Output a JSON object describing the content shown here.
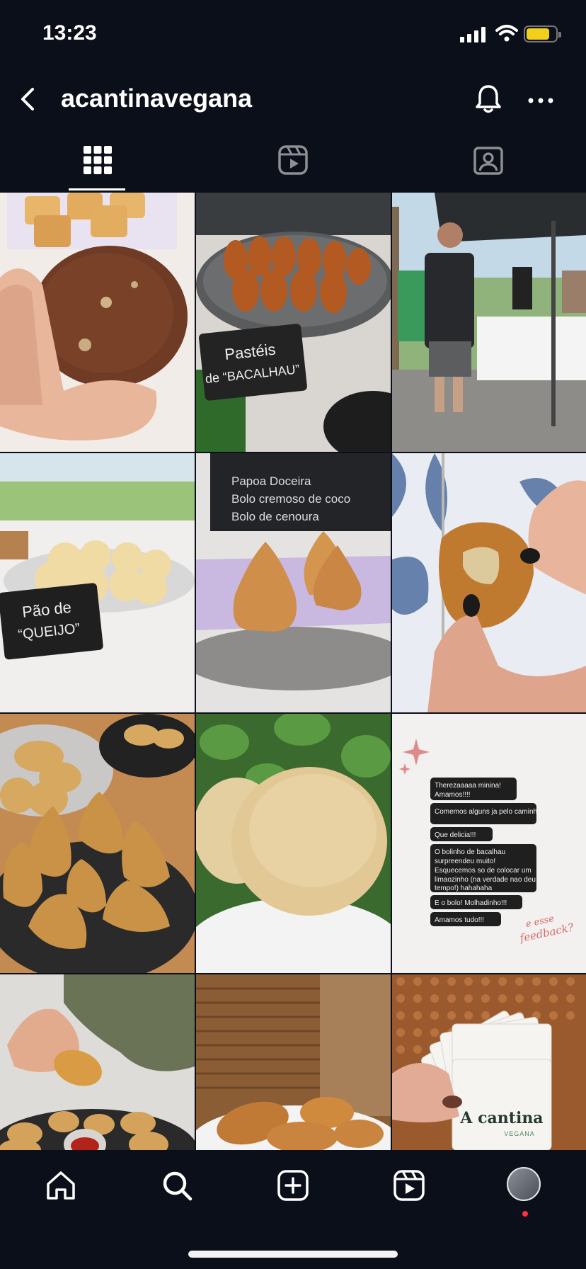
{
  "status_bar": {
    "time": "13:23"
  },
  "header": {
    "username": "acantinavegana"
  },
  "tabs": [
    {
      "icon": "grid-icon"
    },
    {
      "icon": "reels-icon"
    },
    {
      "icon": "tagged-icon"
    }
  ],
  "posts": [
    {
      "labels": []
    },
    {
      "labels": [
        "Pastéis",
        "de “BACALHAU”"
      ]
    },
    {
      "labels": []
    },
    {
      "labels": [
        "Pão de",
        "“QUEIJO”"
      ]
    },
    {
      "labels": [
        "Papoa Doceira",
        "Bolo cremoso de coco",
        "Bolo de cenoura"
      ]
    },
    {
      "labels": []
    },
    {
      "labels": []
    },
    {
      "labels": []
    },
    {
      "labels": [
        "Therezaaaaa minina!",
        "Amamos!!!!",
        "Comemos alguns ja pelo caminho",
        "Que delicia!!!",
        "O bolinho de bacalhau",
        "surpreendeu muito!",
        "Esquecemos so de colocar um",
        "limaozinho (na verdade nao deu",
        "tempo!) hahahaha",
        "E o bolo! Molhadinho!!!",
        "Amamos tudo!!!",
        "e esse",
        "feedback?"
      ]
    },
    {
      "labels": []
    },
    {
      "labels": []
    },
    {
      "labels": [
        "A cantina",
        "VEGANA"
      ]
    }
  ],
  "bottom_nav": [
    "home-icon",
    "search-icon",
    "create-icon",
    "reels-icon",
    "profile-avatar"
  ],
  "colors": {
    "background": "#0b0f19",
    "notification": "#ff3040",
    "battery": "#f2d01a"
  }
}
